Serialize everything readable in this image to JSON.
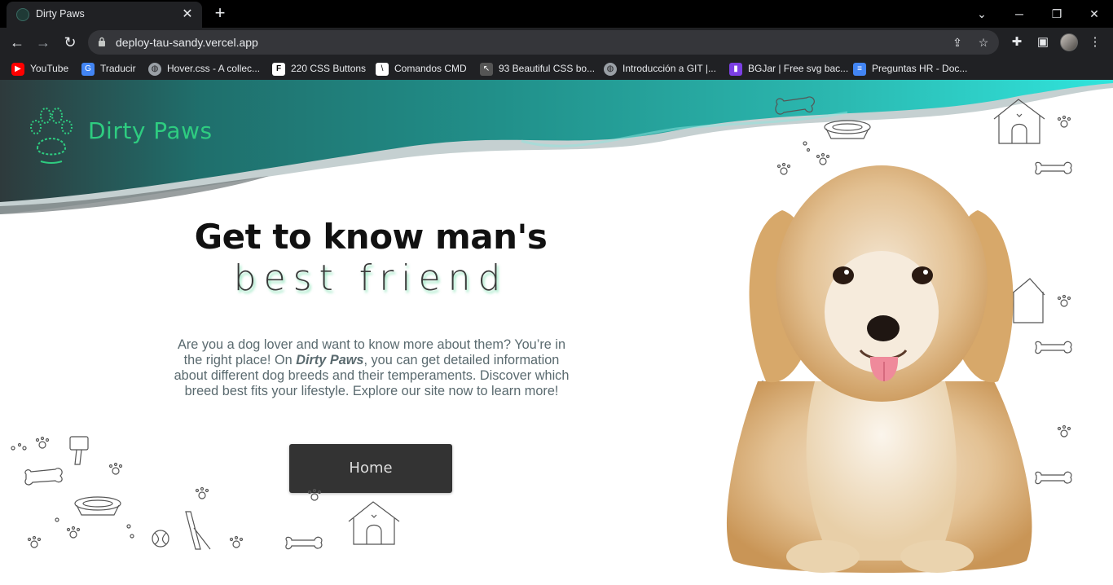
{
  "browser": {
    "tab_title": "Dirty Paws",
    "url": "deploy-tau-sandy.vercel.app",
    "bookmarks": [
      {
        "label": "YouTube",
        "icon": "youtube-icon",
        "color": "#ff0000"
      },
      {
        "label": "Traducir",
        "icon": "translate-icon",
        "color": "#4285f4"
      },
      {
        "label": "Hover.css - A collec...",
        "icon": "globe-icon",
        "color": "#9aa0a6"
      },
      {
        "label": "220 CSS Buttons",
        "icon": "f-logo-icon",
        "color": "#ffffff"
      },
      {
        "label": "Comandos CMD",
        "icon": "cmd-icon",
        "color": "#ffffff"
      },
      {
        "label": "93 Beautiful CSS bo...",
        "icon": "cursor-icon",
        "color": "#555555"
      },
      {
        "label": "Introducción a GIT |...",
        "icon": "globe-icon",
        "color": "#9aa0a6"
      },
      {
        "label": "BGJar | Free svg bac...",
        "icon": "bgjar-icon",
        "color": "#7b3fe4"
      },
      {
        "label": "Preguntas HR - Doc...",
        "icon": "docs-icon",
        "color": "#4285f4"
      }
    ]
  },
  "site": {
    "logo_text": "Dirty Paws",
    "brand_color": "#2ecc80",
    "hero_title": "Get to know man's",
    "hero_subtitle": "best friend",
    "desc_before": "Are you a dog lover and want to know more about them? You’re in the right place! On ",
    "desc_brand": "Dirty Paws",
    "desc_after": ", you can get detailed information about different dog breeds and their temperaments. Discover which breed best fits your lifestyle. Explore our site now to learn more!",
    "home_button": "Home"
  }
}
